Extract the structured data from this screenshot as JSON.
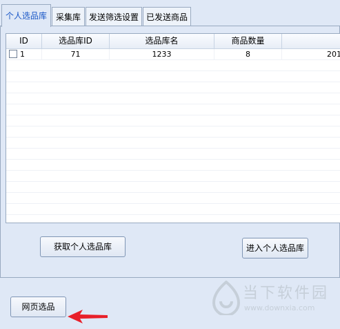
{
  "tabs": [
    {
      "label": "个人选品库",
      "active": true
    },
    {
      "label": "采集库",
      "active": false
    },
    {
      "label": "发送筛选设置",
      "active": false
    },
    {
      "label": "已发送商品",
      "active": false
    }
  ],
  "table": {
    "columns": [
      "ID",
      "选品库ID",
      "选品库名",
      "商品数量",
      ""
    ],
    "rows": [
      {
        "id": "1",
        "lib_id": "71",
        "lib_name": "1233",
        "count": "8",
        "extra": "201",
        "checked": false
      }
    ]
  },
  "buttons": {
    "fetch_label": "获取个人选品库",
    "enter_label": "进入个人选品库",
    "web_pick_label": "网页选品"
  },
  "watermark": {
    "title": "当下软件园",
    "url": "www.downxia.com"
  },
  "colors": {
    "background": "#dfe8f6",
    "active_tab_text": "#1a57c7",
    "arrow": "#e8202a"
  },
  "icons": [
    "checkbox-icon",
    "red-arrow-icon",
    "watermark-logo-icon"
  ]
}
